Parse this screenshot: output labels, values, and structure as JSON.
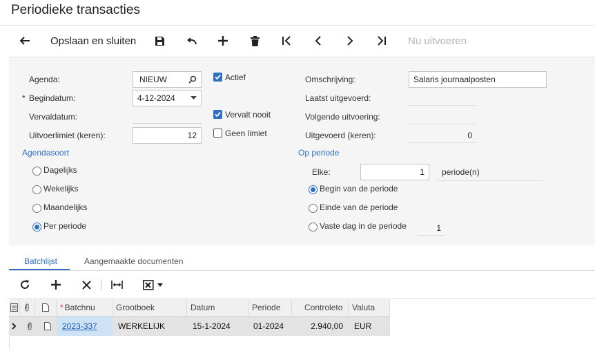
{
  "title": "Periodieke transacties",
  "toolbar": {
    "back_icon": "arrow-left-icon",
    "save_close_label": "Opslaan en sluiten",
    "run_now_label": "Nu uitvoeren"
  },
  "form": {
    "agenda_label": "Agenda:",
    "agenda_value": "NIEUW",
    "actief_label": "Actief",
    "actief_checked": true,
    "omschrijving_label": "Omschrijving:",
    "omschrijving_value": "Salaris journaalposten",
    "required_mark": "*",
    "begindatum_label": "Begindatum:",
    "begindatum_value": "4-12-2024",
    "laatst_label": "Laatst uitgevoerd:",
    "vervaldatum_label": "Vervaldatum:",
    "vervalt_nooit_label": "Vervalt nooit",
    "vervalt_nooit_checked": true,
    "volgende_label": "Volgende uitvoering:",
    "uitvoerlimiet_label": "Uitvoerlimiet (keren):",
    "uitvoerlimiet_value": "12",
    "geen_limiet_label": "Geen limiet",
    "geen_limiet_checked": false,
    "uitgevoerd_label": "Uitgevoerd (keren):",
    "uitgevoerd_value": "0",
    "agendasoort_title": "Agendasoort",
    "agendasoort_options": [
      "Dagelijks",
      "Wekelijks",
      "Maandelijks",
      "Per periode"
    ],
    "agendasoort_selected": "Per periode",
    "op_periode_title": "Op periode",
    "elke_label": "Elke:",
    "elke_value": "1",
    "periode_unit": "periode(n)",
    "periode_options": [
      "Begin van de periode",
      "Einde van de periode",
      "Vaste dag in de periode"
    ],
    "periode_selected": "Begin van de periode",
    "vaste_dag_value": "1"
  },
  "tabs": [
    "Batchlijst",
    "Aangemaakte documenten"
  ],
  "active_tab": "Batchlijst",
  "grid": {
    "columns": [
      "Batchnummer",
      "Grootboek",
      "Datum",
      "Periode",
      "Controletotaal",
      "Valuta"
    ],
    "header_labels": [
      "Batchnu",
      "Grootboek",
      "Datum",
      "Periode",
      "Controleto",
      "Valuta"
    ],
    "rows": [
      {
        "batchnummer": "2023-337",
        "grootboek": "WERKELIJK",
        "datum": "15-1-2024",
        "periode": "01-2024",
        "controletotaal": "2.940,00",
        "valuta": "EUR"
      }
    ]
  },
  "colors": {
    "accent": "#2f6fc4",
    "form_bg": "#f5f5f5",
    "selected_cell": "#cfe3f6"
  }
}
